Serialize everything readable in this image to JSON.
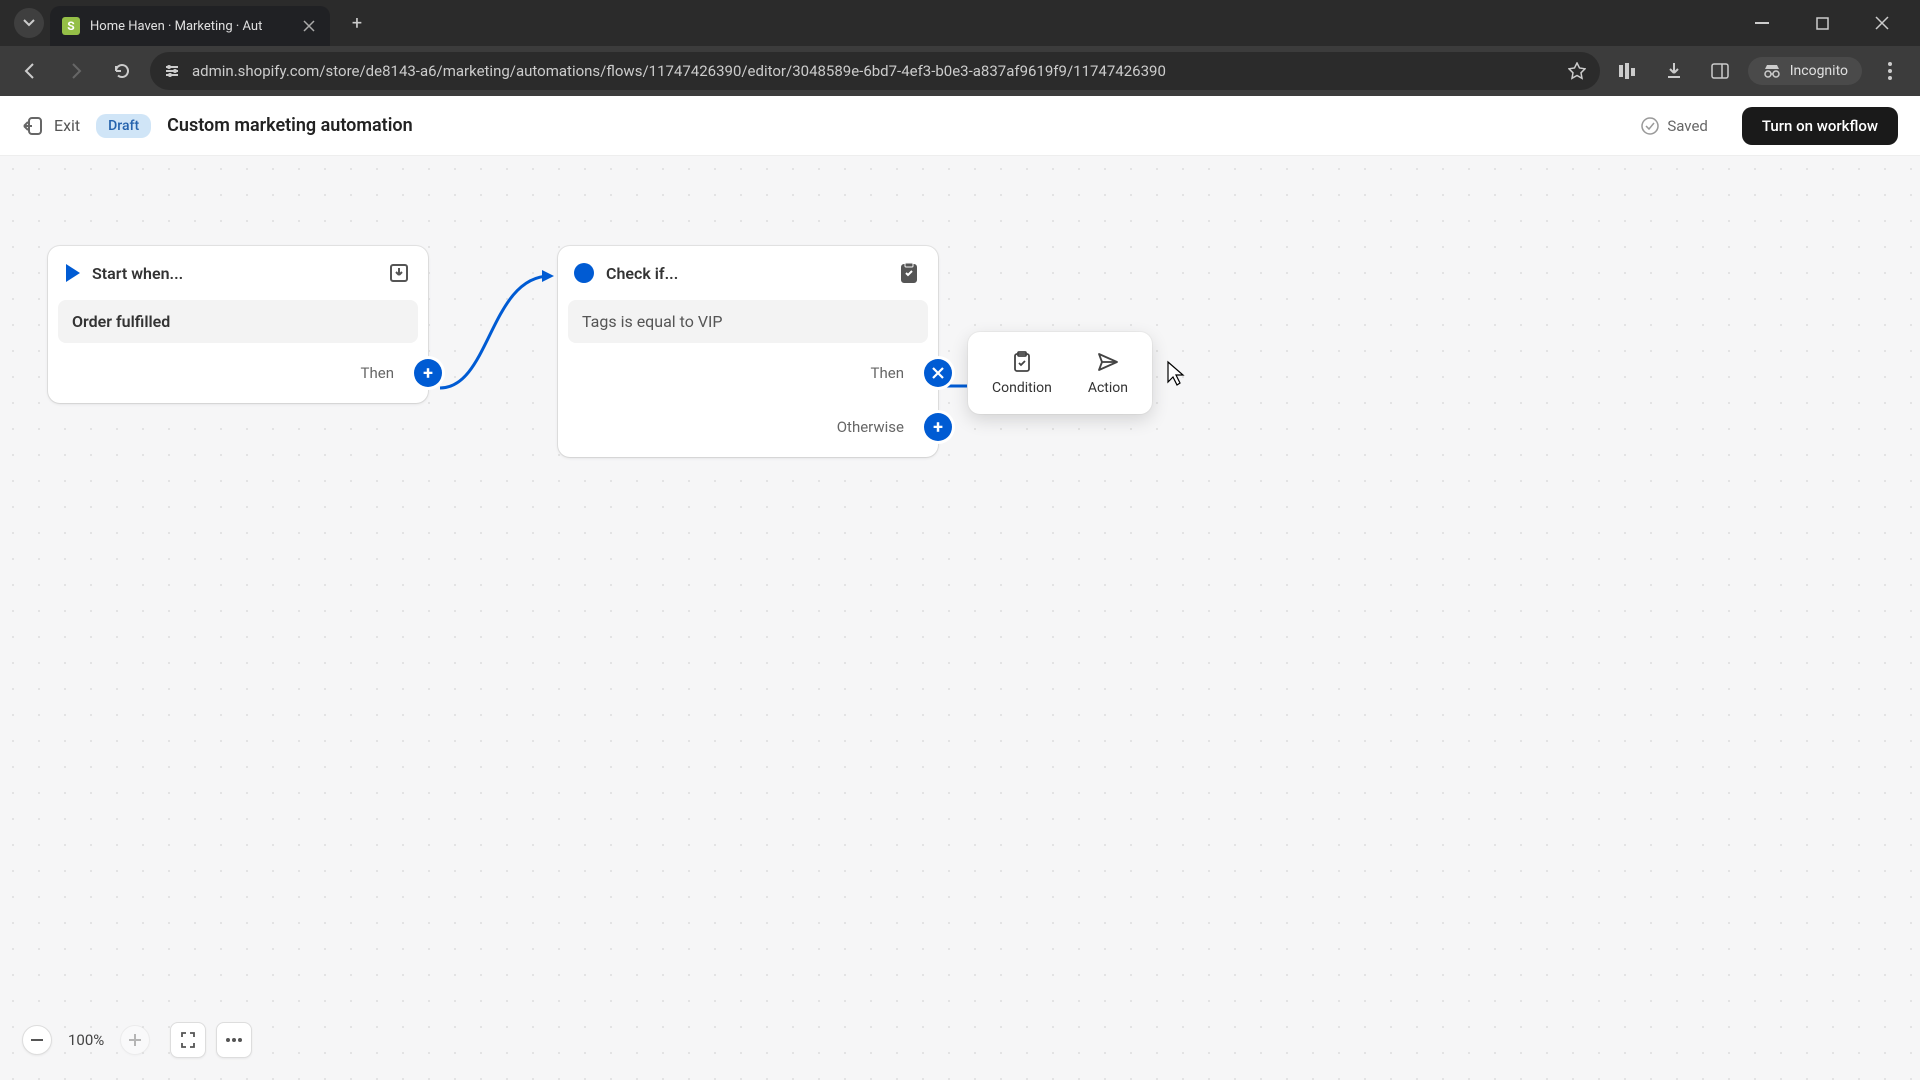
{
  "browser": {
    "tab_title": "Home Haven · Marketing · Aut",
    "url": "admin.shopify.com/store/de8143-a6/marketing/automations/flows/11747426390/editor/3048589e-6bd7-4ef3-b0e3-a837af9619f9/11747426390",
    "incognito_label": "Incognito"
  },
  "header": {
    "exit_label": "Exit",
    "status_badge": "Draft",
    "title": "Custom marketing automation",
    "saved_label": "Saved",
    "turn_on_label": "Turn on workflow"
  },
  "trigger_node": {
    "title": "Start when...",
    "body": "Order fulfilled",
    "branch_then": "Then"
  },
  "condition_node": {
    "title": "Check if...",
    "body": "Tags is equal to VIP",
    "branch_then": "Then",
    "branch_otherwise": "Otherwise"
  },
  "popover": {
    "condition_label": "Condition",
    "action_label": "Action"
  },
  "zoom": {
    "level": "100%"
  }
}
